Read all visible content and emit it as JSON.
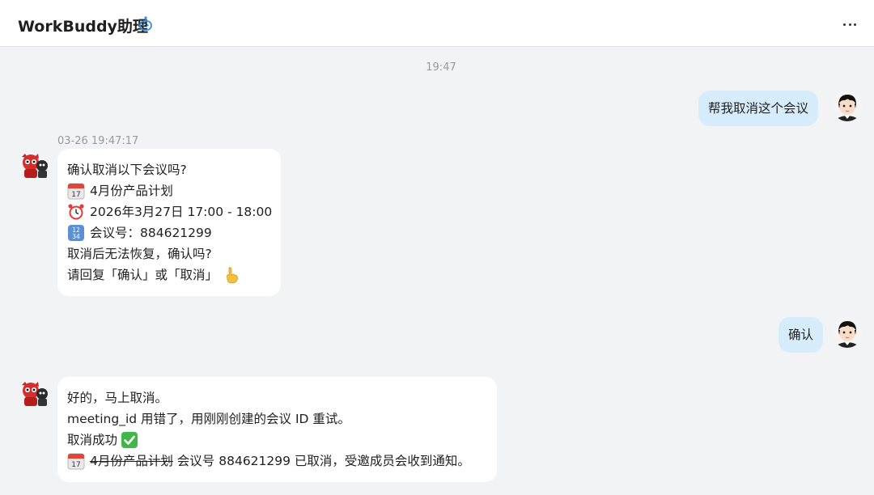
{
  "header": {
    "title": "WorkBuddy助理",
    "badge_icon": "robot-icon",
    "more_icon": "more-horizontal-icon"
  },
  "colors": {
    "user_bubble": "#d7ecfb",
    "bot_bubble": "#ffffff",
    "background": "#f2f3f5",
    "badge_blue": "#3a8dde"
  },
  "chat": {
    "center_time": "19:47",
    "msg1_user": "帮我取消这个会议",
    "msg2_time": "03-26 19:47:17",
    "msg2_lines": [
      "确认取消以下会议吗?",
      "4月份产品计划",
      "2026年3月27日 17:00 - 18:00",
      "会议号：884621299",
      "取消后无法恢复，确认吗?",
      "请回复「确认」或「取消」"
    ],
    "msg3_user": "确认",
    "msg4_lines": [
      "好的，马上取消。",
      "meeting_id 用错了，用刚刚创建的会议 ID 重试。",
      "取消成功",
      "4月份产品计划",
      " 会议号 884621299 已取消，受邀成员会收到通知。"
    ]
  }
}
